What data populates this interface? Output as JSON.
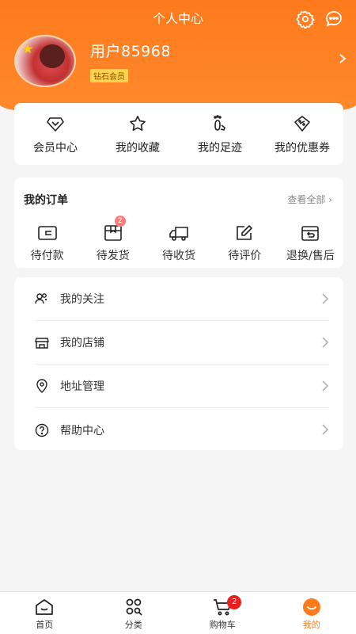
{
  "header": {
    "title": "个人中心",
    "icons": [
      "gear-icon",
      "message-icon"
    ]
  },
  "profile": {
    "username": "用户85968",
    "level": "钻石会员"
  },
  "quick_links": [
    {
      "label": "会员中心",
      "icon": "diamond-icon"
    },
    {
      "label": "我的收藏",
      "icon": "star-icon"
    },
    {
      "label": "我的足迹",
      "icon": "footprint-icon"
    },
    {
      "label": "我的优惠券",
      "icon": "coupon-icon"
    }
  ],
  "orders": {
    "title": "我的订单",
    "view_all": "查看全部",
    "items": [
      {
        "label": "待付款",
        "icon": "wallet-icon"
      },
      {
        "label": "待发货",
        "icon": "package-icon",
        "badge": "2"
      },
      {
        "label": "待收货",
        "icon": "truck-icon"
      },
      {
        "label": "待评价",
        "icon": "edit-icon"
      },
      {
        "label": "退换/售后",
        "icon": "return-icon"
      }
    ]
  },
  "menu": [
    {
      "label": "我的关注",
      "icon": "follow-icon"
    },
    {
      "label": "我的店铺",
      "icon": "store-icon"
    },
    {
      "label": "地址管理",
      "icon": "location-icon"
    },
    {
      "label": "帮助中心",
      "icon": "help-icon"
    }
  ],
  "tabbar": {
    "items": [
      {
        "label": "首页",
        "icon": "home-icon"
      },
      {
        "label": "分类",
        "icon": "category-icon"
      },
      {
        "label": "购物车",
        "icon": "cart-icon",
        "badge": "2"
      },
      {
        "label": "我的",
        "icon": "me-icon",
        "active": true
      }
    ]
  },
  "colors": {
    "accent": "#ff7a1a",
    "badge_red": "#e8201e",
    "level_badge": "#ffd34d"
  }
}
